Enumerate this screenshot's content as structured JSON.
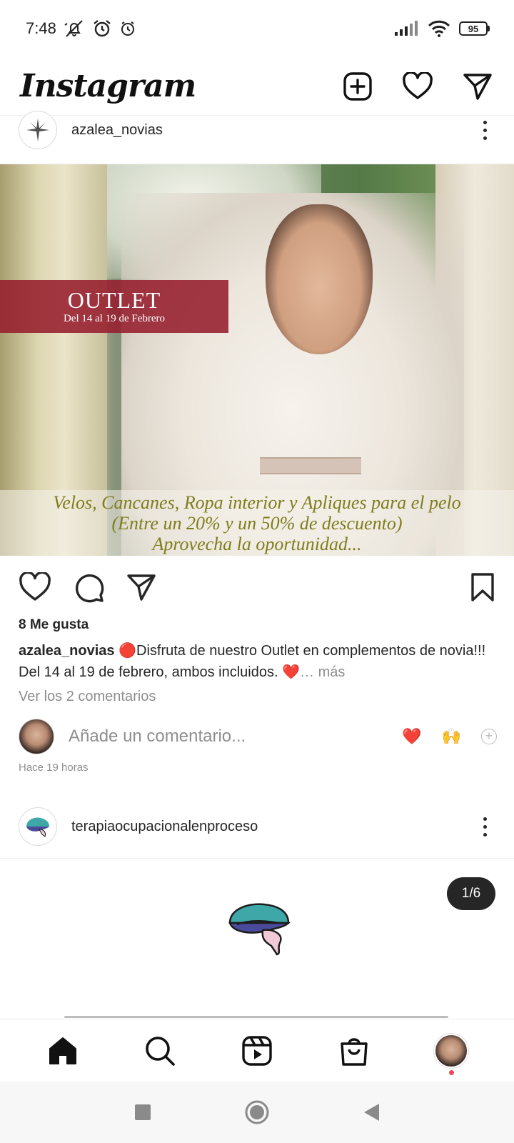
{
  "status_bar": {
    "time": "7:48",
    "battery": "95"
  },
  "header": {
    "logo": "Instagram",
    "icons": [
      "new-post-icon",
      "heart-icon",
      "direct-message-icon"
    ]
  },
  "post1": {
    "username": "azalea_novias",
    "image": {
      "outlet_title": "OUTLET",
      "outlet_dates": "Del 14 al 19 de Febrero",
      "promo_line1": "Velos, Cancanes, Ropa interior y Apliques para el pelo",
      "promo_line2": "(Entre un 20% y un 50% de descuento)",
      "promo_line3": "Aprovecha la oportunidad..."
    },
    "likes": "8 Me gusta",
    "caption_user": "azalea_novias",
    "caption_emoji_start": "🔴",
    "caption_text": "Disfruta de nuestro Outlet en complementos de novia!!! Del 14 al 19 de febrero, ambos incluidos.",
    "caption_emoji_end": "❤️",
    "caption_more": "… más",
    "view_comments": "Ver los 2 comentarios",
    "comment_placeholder": "Añade un comentario...",
    "quick_reactions": [
      "❤️",
      "🙌"
    ],
    "add_reaction": "+",
    "timestamp": "Hace 19 horas"
  },
  "post2": {
    "username": "terapiaocupacionalenproceso",
    "counter": "1/6"
  },
  "bottom_nav": [
    "home-icon",
    "search-icon",
    "reels-icon",
    "shop-icon",
    "profile-avatar"
  ],
  "colors": {
    "accent_red": "#ed4956",
    "outlet_red": "#961e2d",
    "promo_olive": "#7f7d1c"
  }
}
